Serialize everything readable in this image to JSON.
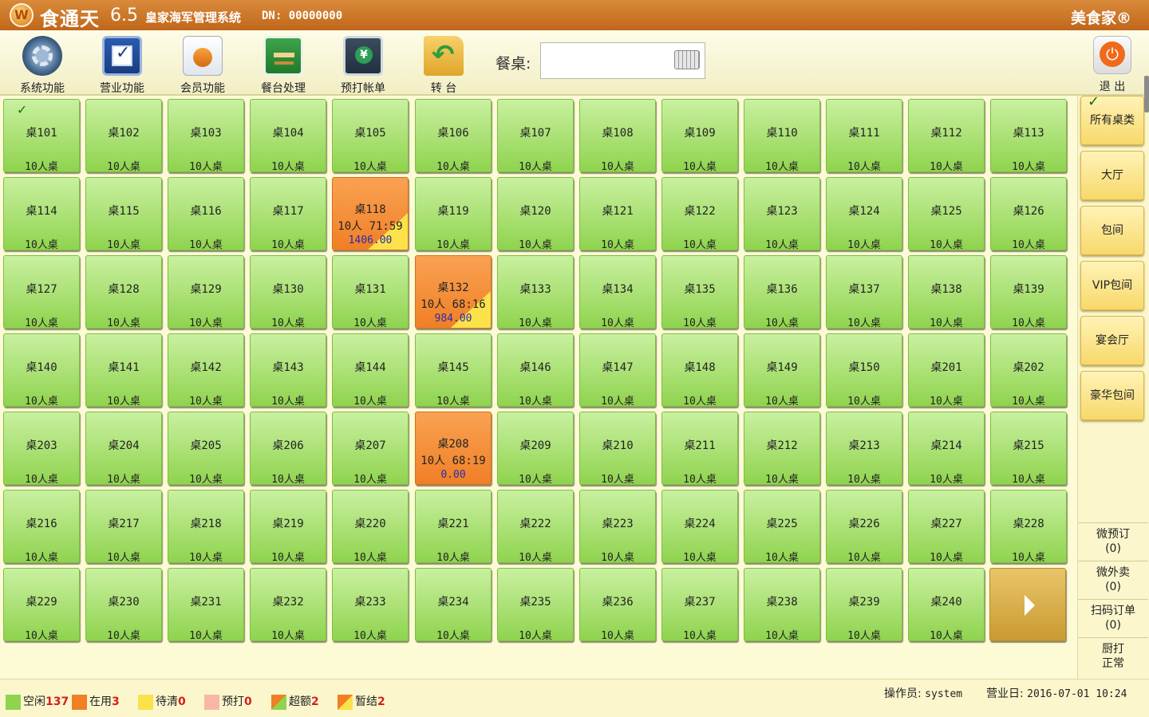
{
  "titlebar": {
    "logo_char": "W",
    "app_name": "食通天",
    "version": "6.5",
    "system_name": "皇家海军管理系统",
    "dn": "DN: 00000000",
    "brand": "美食家®"
  },
  "toolbar": {
    "tools": [
      {
        "label": "系统功能",
        "icon": "gear-icon"
      },
      {
        "label": "营业功能",
        "icon": "checkbox-icon"
      },
      {
        "label": "会员功能",
        "icon": "member-icon"
      },
      {
        "label": "餐台处理",
        "icon": "table-icon"
      },
      {
        "label": "预打帐单",
        "icon": "bill-icon"
      },
      {
        "label": "转 台",
        "icon": "transfer-icon"
      }
    ],
    "search_label": "餐桌:",
    "search_value": "",
    "exit_label": "退 出"
  },
  "tables": [
    {
      "name": "桌101",
      "seat": "10人桌",
      "status": "free",
      "checked": true
    },
    {
      "name": "桌102",
      "seat": "10人桌",
      "status": "free"
    },
    {
      "name": "桌103",
      "seat": "10人桌",
      "status": "free"
    },
    {
      "name": "桌104",
      "seat": "10人桌",
      "status": "free"
    },
    {
      "name": "桌105",
      "seat": "10人桌",
      "status": "free"
    },
    {
      "name": "桌106",
      "seat": "10人桌",
      "status": "free"
    },
    {
      "name": "桌107",
      "seat": "10人桌",
      "status": "free"
    },
    {
      "name": "桌108",
      "seat": "10人桌",
      "status": "free"
    },
    {
      "name": "桌109",
      "seat": "10人桌",
      "status": "free"
    },
    {
      "name": "桌110",
      "seat": "10人桌",
      "status": "free"
    },
    {
      "name": "桌111",
      "seat": "10人桌",
      "status": "free"
    },
    {
      "name": "桌112",
      "seat": "10人桌",
      "status": "free"
    },
    {
      "name": "桌113",
      "seat": "10人桌",
      "status": "free"
    },
    {
      "name": "桌114",
      "seat": "10人桌",
      "status": "free"
    },
    {
      "name": "桌115",
      "seat": "10人桌",
      "status": "free"
    },
    {
      "name": "桌116",
      "seat": "10人桌",
      "status": "free"
    },
    {
      "name": "桌117",
      "seat": "10人桌",
      "status": "free"
    },
    {
      "name": "桌118",
      "status": "busy-over",
      "info": "10人 71:59",
      "amount": "1406.00"
    },
    {
      "name": "桌119",
      "seat": "10人桌",
      "status": "free"
    },
    {
      "name": "桌120",
      "seat": "10人桌",
      "status": "free"
    },
    {
      "name": "桌121",
      "seat": "10人桌",
      "status": "free"
    },
    {
      "name": "桌122",
      "seat": "10人桌",
      "status": "free"
    },
    {
      "name": "桌123",
      "seat": "10人桌",
      "status": "free"
    },
    {
      "name": "桌124",
      "seat": "10人桌",
      "status": "free"
    },
    {
      "name": "桌125",
      "seat": "10人桌",
      "status": "free"
    },
    {
      "name": "桌126",
      "seat": "10人桌",
      "status": "free"
    },
    {
      "name": "桌127",
      "seat": "10人桌",
      "status": "free"
    },
    {
      "name": "桌128",
      "seat": "10人桌",
      "status": "free"
    },
    {
      "name": "桌129",
      "seat": "10人桌",
      "status": "free"
    },
    {
      "name": "桌130",
      "seat": "10人桌",
      "status": "free"
    },
    {
      "name": "桌131",
      "seat": "10人桌",
      "status": "free"
    },
    {
      "name": "桌132",
      "status": "busy-over",
      "info": "10人 68:16",
      "amount": "984.00"
    },
    {
      "name": "桌133",
      "seat": "10人桌",
      "status": "free"
    },
    {
      "name": "桌134",
      "seat": "10人桌",
      "status": "free"
    },
    {
      "name": "桌135",
      "seat": "10人桌",
      "status": "free"
    },
    {
      "name": "桌136",
      "seat": "10人桌",
      "status": "free"
    },
    {
      "name": "桌137",
      "seat": "10人桌",
      "status": "free"
    },
    {
      "name": "桌138",
      "seat": "10人桌",
      "status": "free"
    },
    {
      "name": "桌139",
      "seat": "10人桌",
      "status": "free"
    },
    {
      "name": "桌140",
      "seat": "10人桌",
      "status": "free"
    },
    {
      "name": "桌141",
      "seat": "10人桌",
      "status": "free"
    },
    {
      "name": "桌142",
      "seat": "10人桌",
      "status": "free"
    },
    {
      "name": "桌143",
      "seat": "10人桌",
      "status": "free"
    },
    {
      "name": "桌144",
      "seat": "10人桌",
      "status": "free"
    },
    {
      "name": "桌145",
      "seat": "10人桌",
      "status": "free"
    },
    {
      "name": "桌146",
      "seat": "10人桌",
      "status": "free"
    },
    {
      "name": "桌147",
      "seat": "10人桌",
      "status": "free"
    },
    {
      "name": "桌148",
      "seat": "10人桌",
      "status": "free"
    },
    {
      "name": "桌149",
      "seat": "10人桌",
      "status": "free"
    },
    {
      "name": "桌150",
      "seat": "10人桌",
      "status": "free"
    },
    {
      "name": "桌201",
      "seat": "10人桌",
      "status": "free"
    },
    {
      "name": "桌202",
      "seat": "10人桌",
      "status": "free"
    },
    {
      "name": "桌203",
      "seat": "10人桌",
      "status": "free"
    },
    {
      "name": "桌204",
      "seat": "10人桌",
      "status": "free"
    },
    {
      "name": "桌205",
      "seat": "10人桌",
      "status": "free"
    },
    {
      "name": "桌206",
      "seat": "10人桌",
      "status": "free"
    },
    {
      "name": "桌207",
      "seat": "10人桌",
      "status": "free"
    },
    {
      "name": "桌208",
      "status": "busy",
      "info": "10人 68:19",
      "amount": "0.00"
    },
    {
      "name": "桌209",
      "seat": "10人桌",
      "status": "free"
    },
    {
      "name": "桌210",
      "seat": "10人桌",
      "status": "free"
    },
    {
      "name": "桌211",
      "seat": "10人桌",
      "status": "free"
    },
    {
      "name": "桌212",
      "seat": "10人桌",
      "status": "free"
    },
    {
      "name": "桌213",
      "seat": "10人桌",
      "status": "free"
    },
    {
      "name": "桌214",
      "seat": "10人桌",
      "status": "free"
    },
    {
      "name": "桌215",
      "seat": "10人桌",
      "status": "free"
    },
    {
      "name": "桌216",
      "seat": "10人桌",
      "status": "free"
    },
    {
      "name": "桌217",
      "seat": "10人桌",
      "status": "free"
    },
    {
      "name": "桌218",
      "seat": "10人桌",
      "status": "free"
    },
    {
      "name": "桌219",
      "seat": "10人桌",
      "status": "free"
    },
    {
      "name": "桌220",
      "seat": "10人桌",
      "status": "free"
    },
    {
      "name": "桌221",
      "seat": "10人桌",
      "status": "free"
    },
    {
      "name": "桌222",
      "seat": "10人桌",
      "status": "free"
    },
    {
      "name": "桌223",
      "seat": "10人桌",
      "status": "free"
    },
    {
      "name": "桌224",
      "seat": "10人桌",
      "status": "free"
    },
    {
      "name": "桌225",
      "seat": "10人桌",
      "status": "free"
    },
    {
      "name": "桌226",
      "seat": "10人桌",
      "status": "free"
    },
    {
      "name": "桌227",
      "seat": "10人桌",
      "status": "free"
    },
    {
      "name": "桌228",
      "seat": "10人桌",
      "status": "free"
    },
    {
      "name": "桌229",
      "seat": "10人桌",
      "status": "free"
    },
    {
      "name": "桌230",
      "seat": "10人桌",
      "status": "free"
    },
    {
      "name": "桌231",
      "seat": "10人桌",
      "status": "free"
    },
    {
      "name": "桌232",
      "seat": "10人桌",
      "status": "free"
    },
    {
      "name": "桌233",
      "seat": "10人桌",
      "status": "free"
    },
    {
      "name": "桌234",
      "seat": "10人桌",
      "status": "free"
    },
    {
      "name": "桌235",
      "seat": "10人桌",
      "status": "free"
    },
    {
      "name": "桌236",
      "seat": "10人桌",
      "status": "free"
    },
    {
      "name": "桌237",
      "seat": "10人桌",
      "status": "free"
    },
    {
      "name": "桌238",
      "seat": "10人桌",
      "status": "free"
    },
    {
      "name": "桌239",
      "seat": "10人桌",
      "status": "free"
    },
    {
      "name": "桌240",
      "seat": "10人桌",
      "status": "free"
    }
  ],
  "categories": [
    {
      "label": "所有桌类",
      "checked": true
    },
    {
      "label": "大厅"
    },
    {
      "label": "包间"
    },
    {
      "label": "VIP包间"
    },
    {
      "label": "宴会厅"
    },
    {
      "label": "豪华包间"
    }
  ],
  "side_items": [
    {
      "line1": "微预订",
      "line2": "(0)"
    },
    {
      "line1": "微外卖",
      "line2": "(0)"
    },
    {
      "line1": "扫码订单",
      "line2": "(0)"
    },
    {
      "line1": "厨打",
      "line2": "正常"
    }
  ],
  "legend": [
    {
      "label": "空闲",
      "count": "137",
      "color": "#8fd34e"
    },
    {
      "label": "在用",
      "count": "3",
      "color": "#f07f25"
    },
    {
      "label": "待清",
      "count": "0",
      "color": "#fbe24a"
    },
    {
      "label": "预打",
      "count": "0",
      "color": "#f8b7a6"
    },
    {
      "label": "超额",
      "count": "2",
      "color": "split-orange-green"
    },
    {
      "label": "暂结",
      "count": "2",
      "color": "split-orange-yellow"
    }
  ],
  "status": {
    "operator_label": "操作员:",
    "operator": "system",
    "date_label": "营业日:",
    "date": "2016-07-01 10:24"
  }
}
